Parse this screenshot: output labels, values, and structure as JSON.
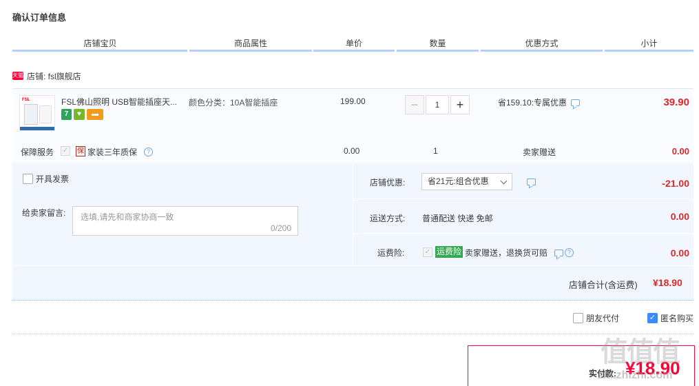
{
  "page_title": "确认订单信息",
  "columns": [
    "店铺宝贝",
    "商品属性",
    "单价",
    "数量",
    "优惠方式",
    "小计"
  ],
  "shop": {
    "icon_text": "天猫",
    "label": "店铺: fsl旗舰店"
  },
  "item": {
    "thumb_brand": "FSL",
    "name": "FSL佛山照明 USB智能插座天...",
    "badge_seven": "7",
    "badge_shield": "♥",
    "badge_card": "▬",
    "attribute": "颜色分类：10A智能插座",
    "unit_price": "199.00",
    "qty_minus": "−",
    "quantity": "1",
    "qty_plus": "+",
    "promo": "省159.10:专属优惠",
    "subtotal": "39.90"
  },
  "service": {
    "label": "保障服务",
    "check": "✓",
    "icon": "保",
    "name": "家装三年质保",
    "help": "?",
    "price": "0.00",
    "qty": "1",
    "gift": "卖家赠送",
    "subtotal": "0.00"
  },
  "invoice": {
    "label": "开具发票"
  },
  "message": {
    "label": "给卖家留言:",
    "placeholder": "选填,请先和商家协商一致",
    "count": "0/200"
  },
  "discount": {
    "label": "店铺优惠:",
    "selected": "省21元:组合优惠",
    "value": "-21.00"
  },
  "shipping": {
    "label": "运送方式:",
    "method": "普通配送 快递 免邮",
    "value": "0.00"
  },
  "insurance": {
    "label": "运费险:",
    "check": "✓",
    "badge": "运费险",
    "text": "卖家赠送，退换货可赔",
    "help": "?",
    "value": "0.00"
  },
  "shop_total": {
    "label": "店铺合计(含运费)",
    "value": "¥18.90"
  },
  "options": {
    "friend_pay": "朋友代付",
    "anonymous": "匿名购买",
    "anonymous_check": "✓"
  },
  "payment": {
    "label": "实付款:",
    "amount": "¥18.90"
  },
  "watermark": {
    "main": "值值值",
    "sub": "zhi.zhizhi.com"
  },
  "colors": {
    "accent_red": "#dd2727",
    "brand_red": "#ff0036",
    "header_line": "#b2d1ff",
    "panel_bg": "#f2f7ff"
  }
}
